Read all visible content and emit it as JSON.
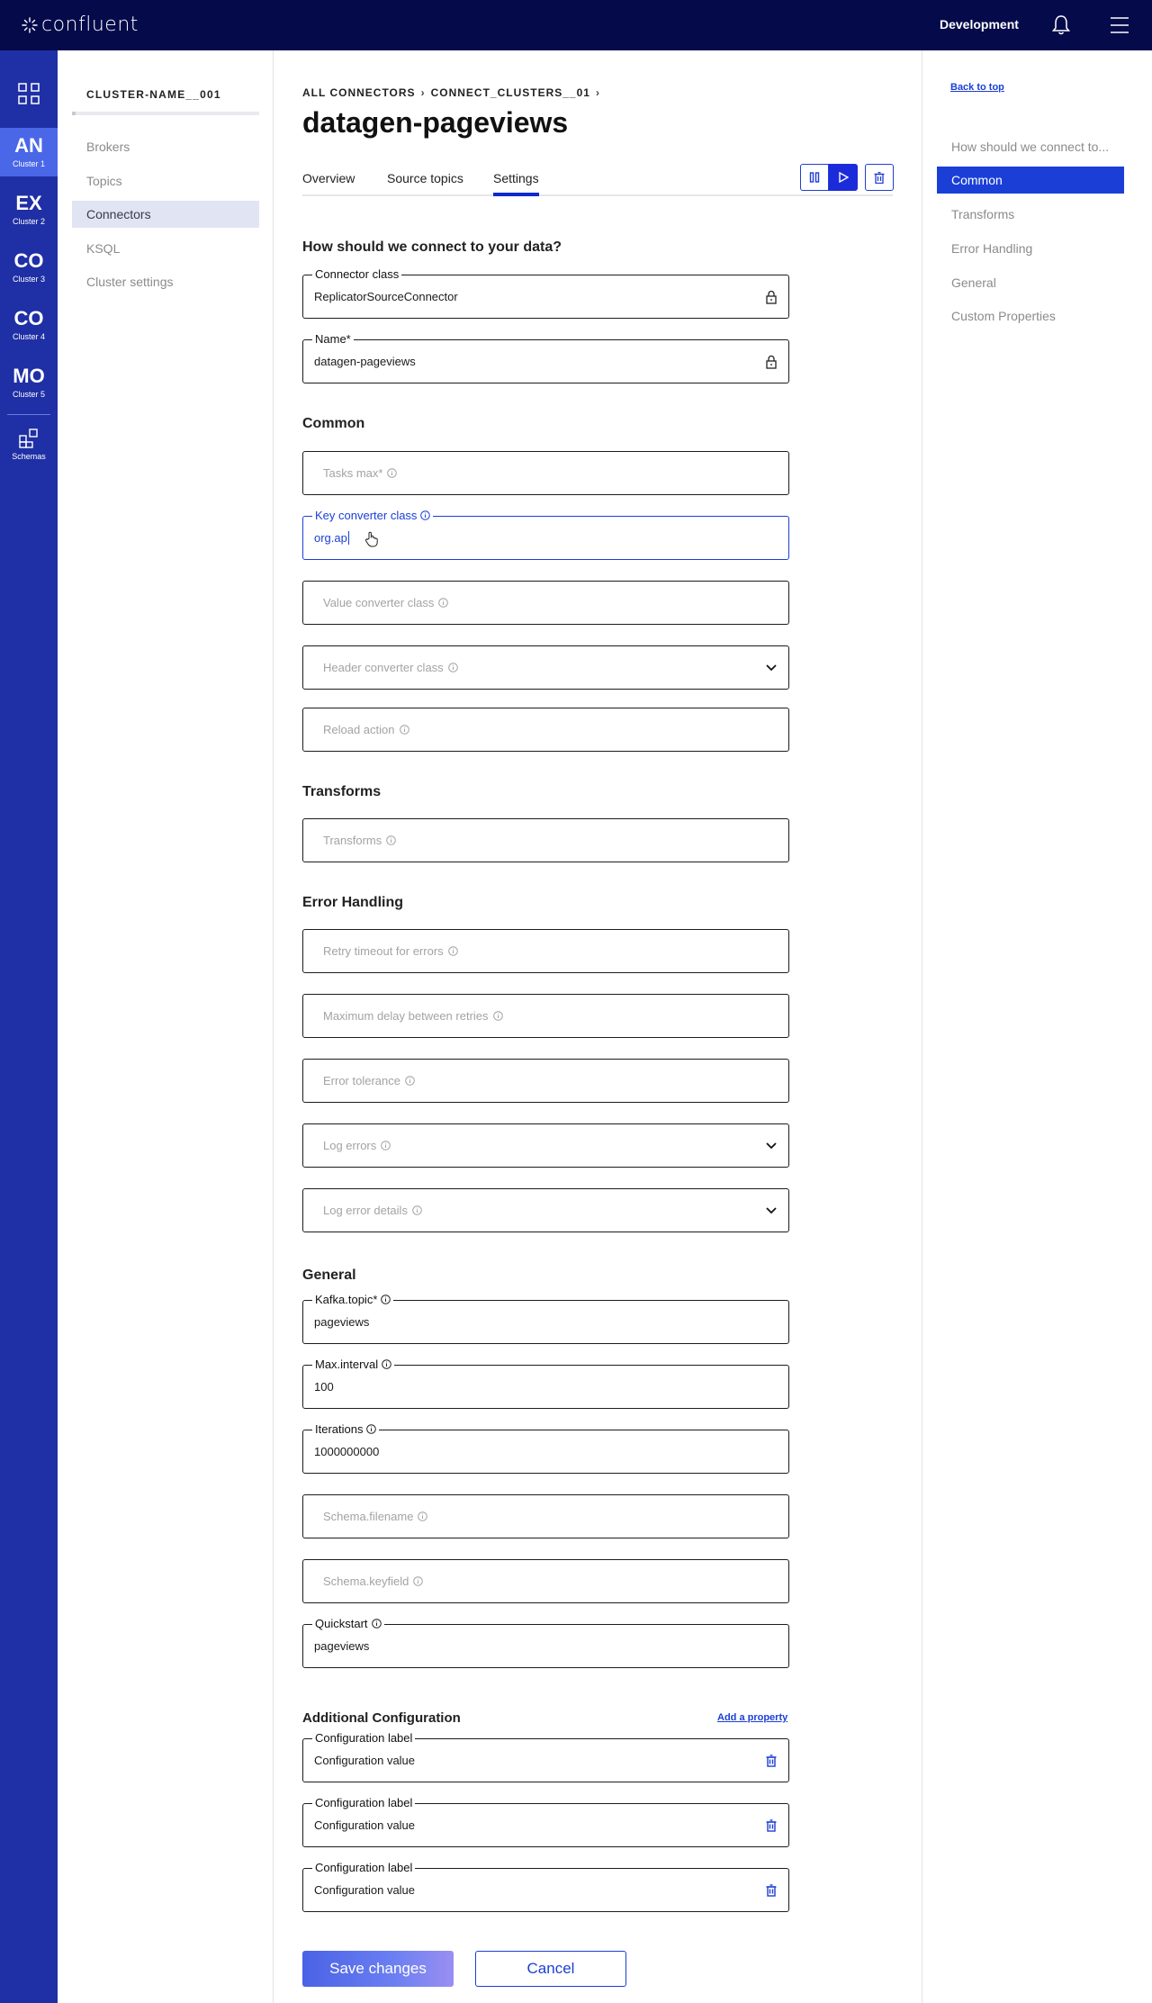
{
  "topbar": {
    "logo": "confluent",
    "environment": "Development",
    "icons": {
      "bell": "bell-icon",
      "menu": "hamburger-icon"
    }
  },
  "rail": {
    "clusters": [
      {
        "abbr": "AN",
        "label": "Cluster 1",
        "active": true
      },
      {
        "abbr": "EX",
        "label": "Cluster 2",
        "active": false
      },
      {
        "abbr": "CO",
        "label": "Cluster 3",
        "active": false
      },
      {
        "abbr": "CO",
        "label": "Cluster 4",
        "active": false
      },
      {
        "abbr": "MO",
        "label": "Cluster 5",
        "active": false
      }
    ],
    "schemas_label": "Schemas"
  },
  "cluster_nav": {
    "title": "CLUSTER-NAME__001",
    "items": [
      {
        "label": "Brokers",
        "active": false
      },
      {
        "label": "Topics",
        "active": false
      },
      {
        "label": "Connectors",
        "active": true
      },
      {
        "label": "KSQL",
        "active": false
      },
      {
        "label": "Cluster settings",
        "active": false
      }
    ]
  },
  "breadcrumb": {
    "root": "ALL CONNECTORS",
    "cluster": "CONNECT_CLUSTERS__01"
  },
  "page_title": "datagen-pageviews",
  "tabs": [
    {
      "label": "Overview",
      "active": false
    },
    {
      "label": "Source topics",
      "active": false
    },
    {
      "label": "Settings",
      "active": true
    }
  ],
  "sections": {
    "connect": "How should we connect to your data?",
    "common": "Common",
    "transforms": "Transforms",
    "error_handling": "Error Handling",
    "general": "General",
    "additional": "Additional Configuration"
  },
  "fields": {
    "connector_class": {
      "label": "Connector class",
      "value": "ReplicatorSourceConnector"
    },
    "name": {
      "label": "Name*",
      "value": "datagen-pageviews"
    },
    "tasks_max": {
      "placeholder": "Tasks max*"
    },
    "key_converter": {
      "label": "Key converter class",
      "value": "org.ap"
    },
    "value_converter": {
      "placeholder": "Value converter class"
    },
    "header_converter": {
      "placeholder": "Header converter class"
    },
    "reload_action": {
      "placeholder": "Reload action"
    },
    "transforms": {
      "placeholder": "Transforms"
    },
    "retry_timeout": {
      "placeholder": "Retry timeout for errors"
    },
    "max_delay": {
      "placeholder": "Maximum delay between retries"
    },
    "error_tolerance": {
      "placeholder": "Error tolerance"
    },
    "log_errors": {
      "placeholder": "Log errors"
    },
    "log_error_details": {
      "placeholder": "Log error details"
    },
    "kafka_topic": {
      "label": "Kafka.topic*",
      "value": "pageviews"
    },
    "max_interval": {
      "label": "Max.interval",
      "value": "100"
    },
    "iterations": {
      "label": "Iterations",
      "value": "1000000000"
    },
    "schema_filename": {
      "placeholder": "Schema.filename"
    },
    "schema_keyfield": {
      "placeholder": "Schema.keyfield"
    },
    "quickstart": {
      "label": "Quickstart",
      "value": "pageviews"
    }
  },
  "additional": {
    "add_property": "Add a property",
    "rows": [
      {
        "label": "Configuration label",
        "value": "Configuration value"
      },
      {
        "label": "Configuration label",
        "value": "Configuration value"
      },
      {
        "label": "Configuration label",
        "value": "Configuration value"
      }
    ]
  },
  "actions": {
    "save": "Save changes",
    "cancel": "Cancel"
  },
  "toc": {
    "back_to_top": "Back to top",
    "items": [
      {
        "label": "How should we connect to...",
        "active": false
      },
      {
        "label": "Common",
        "active": true
      },
      {
        "label": "Transforms",
        "active": false
      },
      {
        "label": "Error Handling",
        "active": false
      },
      {
        "label": "General",
        "active": false
      },
      {
        "label": "Custom Properties",
        "active": false
      }
    ]
  },
  "colors": {
    "topbar": "#040a4a",
    "rail": "#1f2fa5",
    "accent": "#1b3fd6",
    "rail_active": "#4a67e8"
  }
}
